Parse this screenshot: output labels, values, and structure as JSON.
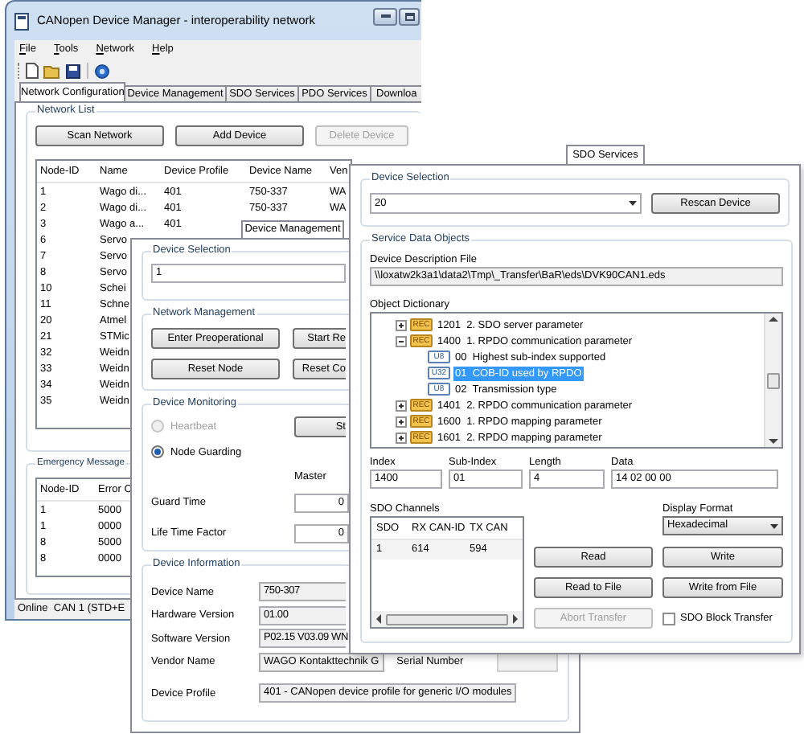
{
  "main_window": {
    "title": "CANopen Device Manager - interoperability network",
    "menu": [
      "File",
      "Tools",
      "Network",
      "Help"
    ],
    "tabs": [
      {
        "label": "Network Configuration",
        "selected": true
      },
      {
        "label": "Device Management",
        "selected": false
      },
      {
        "label": "SDO Services",
        "selected": false
      },
      {
        "label": "PDO Services",
        "selected": false
      },
      {
        "label": "Downloa",
        "selected": false
      }
    ],
    "network_list": {
      "title": "Network List",
      "buttons": [
        {
          "label": "Scan Network",
          "disabled": false
        },
        {
          "label": "Add Device",
          "disabled": false
        },
        {
          "label": "Delete Device",
          "disabled": true
        }
      ],
      "columns": [
        "Node-ID",
        "Name",
        "Device Profile",
        "Device Name",
        "Ven"
      ],
      "rows": [
        [
          "1",
          "Wago di...",
          "401",
          "750-337",
          "WA"
        ],
        [
          "2",
          "Wago di...",
          "401",
          "750-337",
          "WA"
        ],
        [
          "3",
          "Wago a...",
          "401"
        ],
        [
          "6",
          "Servo"
        ],
        [
          "7",
          "Servo"
        ],
        [
          "8",
          "Servo"
        ],
        [
          "10",
          "Schei"
        ],
        [
          "11",
          "Schne"
        ],
        [
          "20",
          "Atmel"
        ],
        [
          "21",
          "STMic"
        ],
        [
          "32",
          "Weidn"
        ],
        [
          "33",
          "Weidn"
        ],
        [
          "34",
          "Weidn"
        ],
        [
          "35",
          "Weidn"
        ]
      ]
    },
    "emergency_messages": {
      "title": "Emergency Message",
      "columns": [
        "Node-ID",
        "Error C"
      ],
      "rows": [
        [
          "1",
          "5000"
        ],
        [
          "1",
          "0000"
        ],
        [
          "8",
          "5000"
        ],
        [
          "8",
          "0000"
        ]
      ]
    },
    "status_bar": "Online  CAN 1 (STD+E"
  },
  "device_management": {
    "tab": "Device Management",
    "device_selection": {
      "title": "Device Selection",
      "value": "1"
    },
    "network_management": {
      "title": "Network Management",
      "buttons": [
        "Enter Preoperational",
        "Start Re",
        "Reset Node",
        "Reset Co"
      ]
    },
    "device_monitoring": {
      "title": "Device Monitoring",
      "options": [
        {
          "label": "Heartbeat",
          "selected": false,
          "disabled": true
        },
        {
          "label": "Node Guarding",
          "selected": true,
          "disabled": false
        }
      ],
      "button": "St",
      "master_label": "Master",
      "fields": [
        {
          "label": "Guard Time",
          "value": "0"
        },
        {
          "label": "Life Time Factor",
          "value": "0"
        }
      ]
    },
    "device_information": {
      "title": "Device Information",
      "fields": [
        {
          "label": "Device Name",
          "value": "750-307"
        },
        {
          "label": "Hardware Version",
          "value": "01.00"
        },
        {
          "label": "Software Version",
          "value": "P02.15 V03.09 WN"
        },
        {
          "label": "Vendor Name",
          "value": "WAGO Kontakttechnik G"
        },
        {
          "label": "Device Profile",
          "value": "401 - CANopen device profile for generic I/O modules"
        }
      ],
      "serial_number_label": "Serial Number"
    }
  },
  "sdo_services": {
    "tab": "SDO Services",
    "device_selection": {
      "title": "Device Selection",
      "value": "20",
      "button": "Rescan Device"
    },
    "service_data_objects": {
      "title": "Service Data Objects",
      "file_label": "Device Description File",
      "file": "\\\\loxatw2k3a1\\data2\\Tmp\\_Transfer\\BaR\\eds\\DVK90CAN1.eds",
      "dictionary_label": "Object Dictionary",
      "tree": [
        {
          "type": "REC",
          "label": "1201  2. SDO server parameter",
          "expanded": false,
          "selected": false
        },
        {
          "type": "REC",
          "label": "1400  1. RPDO communication parameter",
          "expanded": true,
          "selected": false,
          "children": [
            {
              "type": "U8",
              "label": "00  Highest sub-index supported",
              "selected": false
            },
            {
              "type": "U32",
              "label": "01  COB-ID used by RPDO",
              "selected": true
            },
            {
              "type": "U8",
              "label": "02  Transmission type",
              "selected": false
            }
          ]
        },
        {
          "type": "REC",
          "label": "1401  2. RPDO communication parameter",
          "expanded": false,
          "selected": false
        },
        {
          "type": "REC",
          "label": "1600  1. RPDO mapping parameter",
          "expanded": false,
          "selected": false
        },
        {
          "type": "REC",
          "label": "1601  2. RPDO mapping parameter",
          "expanded": false,
          "selected": false
        }
      ],
      "fields": [
        {
          "label": "Index",
          "value": "1400"
        },
        {
          "label": "Sub-Index",
          "value": "01"
        },
        {
          "label": "Length",
          "value": "4"
        },
        {
          "label": "Data",
          "value": "14 02 00 00"
        }
      ],
      "channels": {
        "title": "SDO Channels",
        "columns": [
          "SDO",
          "RX CAN-ID",
          "TX CAN"
        ],
        "rows": [
          [
            "1",
            "614",
            "594"
          ]
        ]
      },
      "display_format": {
        "label": "Display Format",
        "value": "Hexadecimal"
      },
      "buttons": [
        {
          "label": "Read",
          "disabled": false
        },
        {
          "label": "Write",
          "disabled": false
        },
        {
          "label": "Read to File",
          "disabled": false
        },
        {
          "label": "Write from File",
          "disabled": false
        },
        {
          "label": "Abort Transfer",
          "disabled": true
        }
      ],
      "block_transfer": {
        "label": "SDO Block Transfer",
        "checked": false
      }
    }
  }
}
